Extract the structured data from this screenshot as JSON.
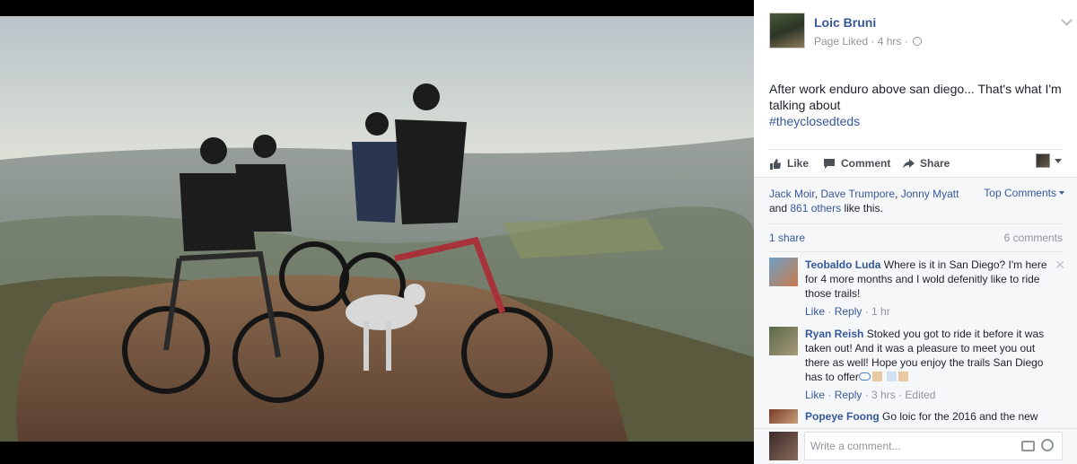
{
  "post": {
    "author": "Loic Bruni",
    "meta_status": "Page Liked",
    "meta_separator": "·",
    "meta_time": "4 hrs",
    "text": "After work enduro above san diego... That's what I'm talking about",
    "hashtag": "#theyclosedteds"
  },
  "actions": {
    "like": "Like",
    "comment": "Comment",
    "share": "Share"
  },
  "reactions": {
    "name_1": "Jack Moir",
    "name_2": "Dave Trumpore",
    "name_3": "Jonny Myatt",
    "and_word": "and",
    "others": "861 others",
    "suffix": "like this.",
    "top_comments": "Top Comments",
    "shares": "1 share",
    "comments_count": "6 comments"
  },
  "comments": [
    {
      "name": "Teobaldo Luda",
      "text": "Where is it in San Diego? I'm here for 4 more months and I wold defenitly like to ride those trails!",
      "like": "Like",
      "reply": "Reply",
      "time": "1 hr",
      "close": "✕"
    },
    {
      "name": "Ryan Reish",
      "text": "Stoked you got to ride it before it was taken out! And it was a pleasure to meet you out there as well! Hope you enjoy the trails San Diego has to offer",
      "like": "Like",
      "reply": "Reply",
      "time": "3 hrs",
      "edited": "Edited"
    },
    {
      "name": "Popeye Foong",
      "text": "Go loic for the 2016 and the new"
    }
  ],
  "compose": {
    "placeholder": "Write a comment..."
  },
  "colors": {
    "link": "#365899",
    "muted": "#90949c",
    "text": "#1d2129"
  },
  "icons": [
    "thumbs-up-icon",
    "comment-icon",
    "share-arrow-icon",
    "chevron-down-icon",
    "globe-icon",
    "close-icon",
    "camera-icon",
    "smiley-icon"
  ]
}
